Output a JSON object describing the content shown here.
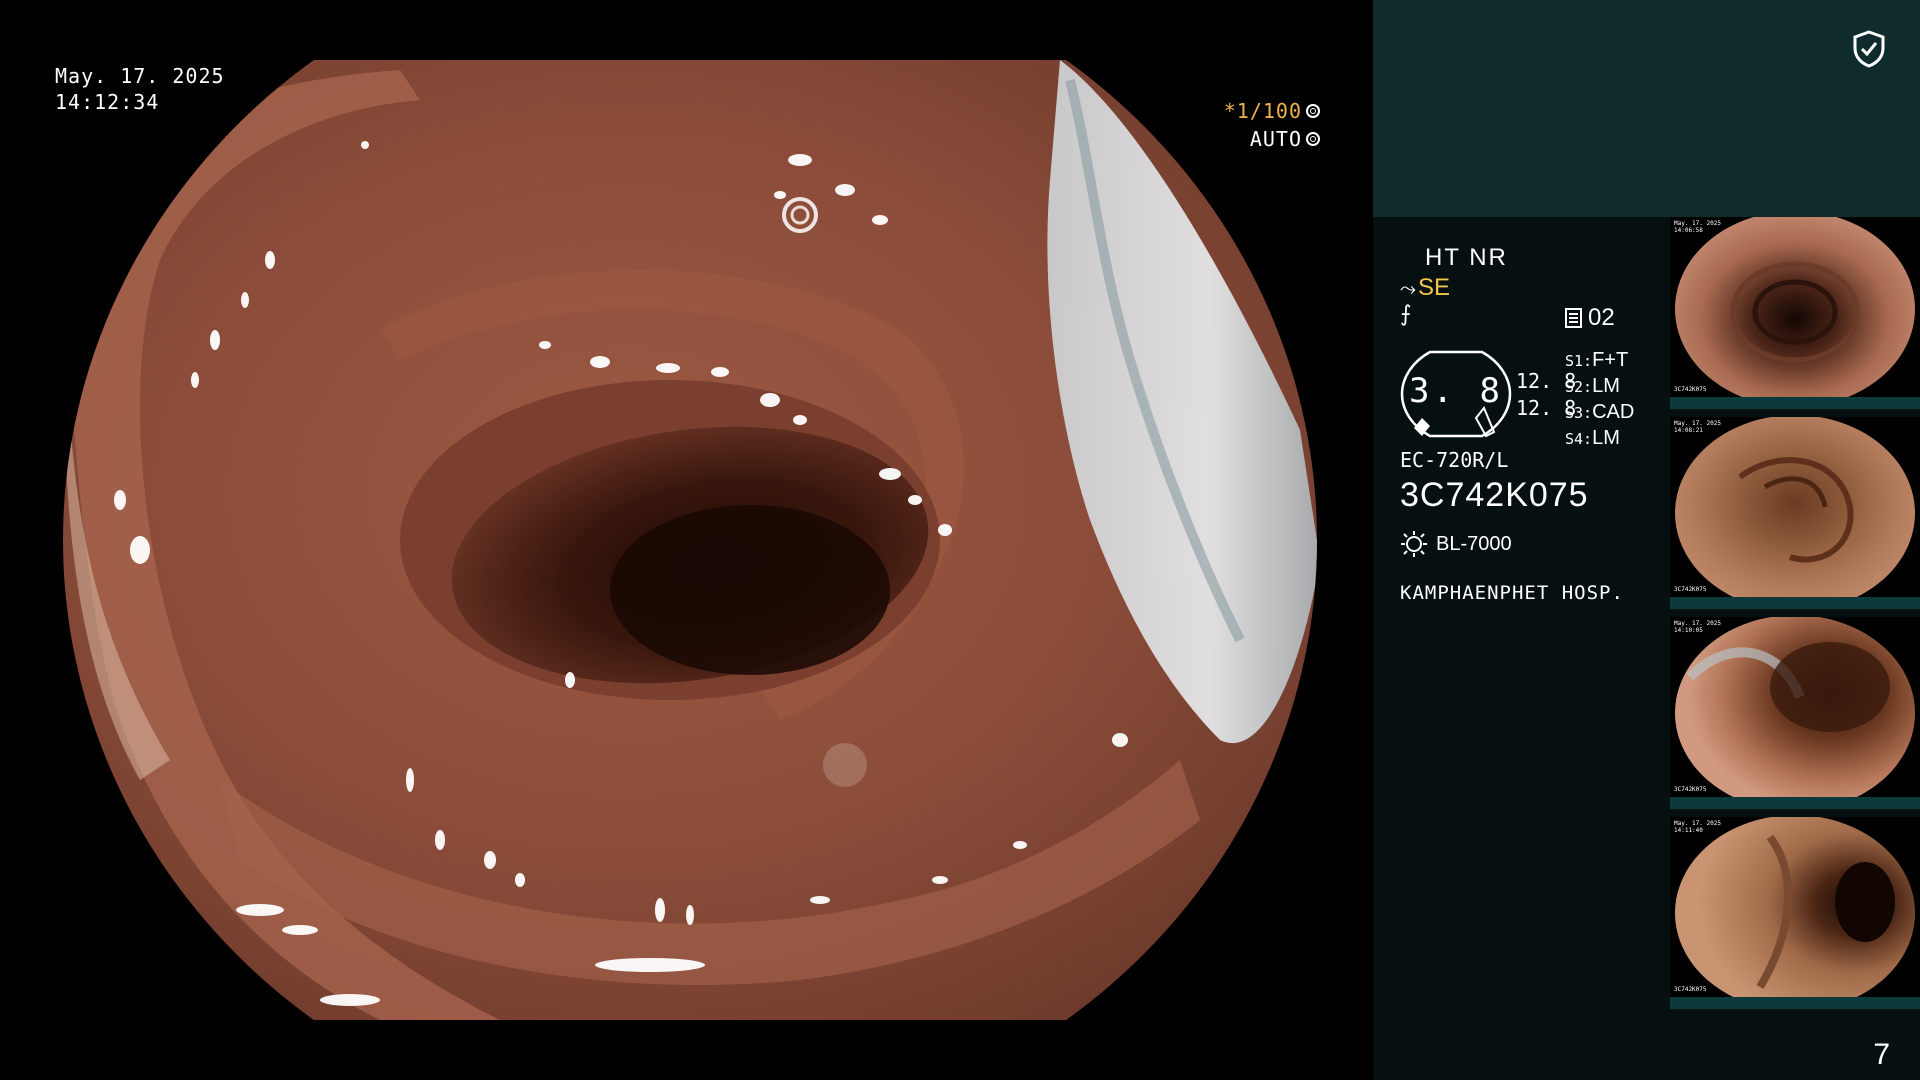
{
  "overlay": {
    "date": "May. 17. 2025",
    "time": "14:12:34",
    "shutter": "*1/100",
    "mode": "AUTO"
  },
  "info": {
    "ht_nr": "HT NR",
    "se": "SE",
    "f_symbol": "⨍",
    "doc_number": "02",
    "gauge_value": "3. 8",
    "gauge_nums": [
      "12. 8",
      "12. 8"
    ],
    "settings": [
      {
        "key": "S1:",
        "value": "F+T"
      },
      {
        "key": "S2:",
        "value": "LM"
      },
      {
        "key": "S3:",
        "value": "CAD"
      },
      {
        "key": "S4:",
        "value": "LM"
      }
    ],
    "model": "EC-720R/L",
    "serial": "3C742K075",
    "light_source": "BL-7000",
    "hospital": "KAMPHAENPHET HOSP."
  },
  "icons": {
    "shield": "shield-check-icon",
    "light": "sun-icon",
    "doc": "document-icon",
    "ring": "ring-icon"
  },
  "colors": {
    "panel_top": "#0f2b2b",
    "panel_body": "#061010",
    "accent_yellow": "#f3c64a",
    "tissue": "#8a4f3c"
  },
  "thumbnails": [
    {
      "date": "May. 17. 2025",
      "time": "14:06:58",
      "serial": "3C742K075"
    },
    {
      "date": "May. 17. 2025",
      "time": "14:08:21",
      "serial": "3C742K075"
    },
    {
      "date": "May. 17. 2025",
      "time": "14:10:05",
      "serial": "3C742K075"
    },
    {
      "date": "May. 17. 2025",
      "time": "14:11:40",
      "serial": "3C742K075"
    }
  ],
  "page_number": "7"
}
